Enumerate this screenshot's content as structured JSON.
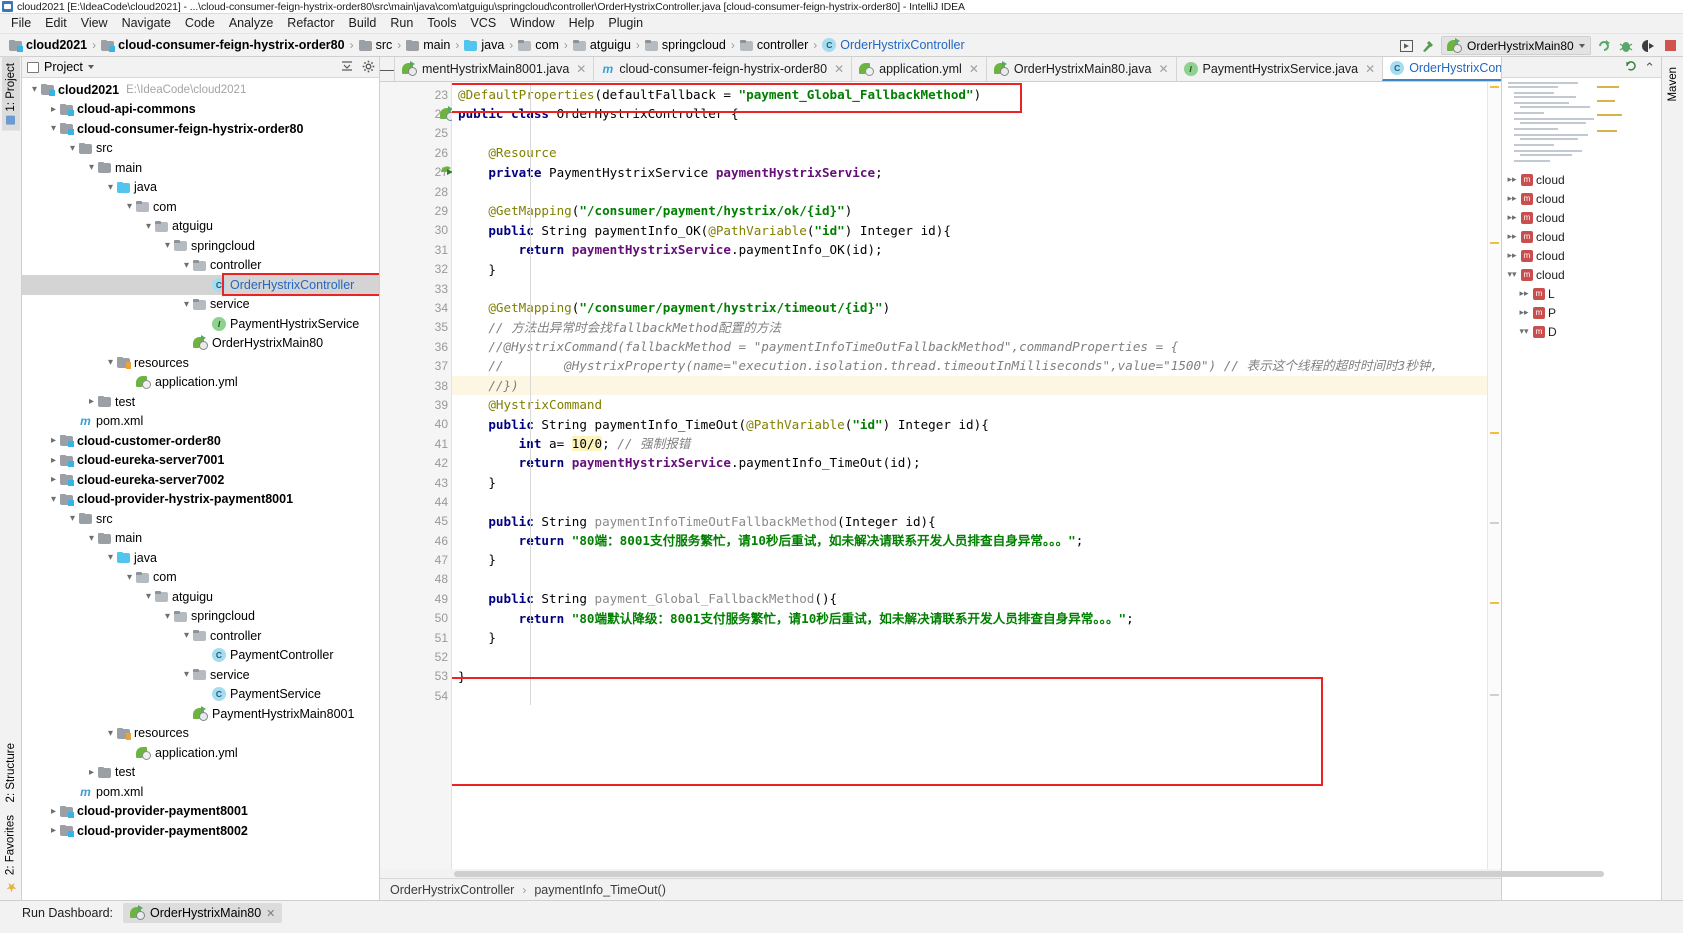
{
  "window": {
    "title": "cloud2021 [E:\\IdeaCode\\cloud2021] - ...\\cloud-consumer-feign-hystrix-order80\\src\\main\\java\\com\\atguigu\\springcloud\\controller\\OrderHystrixController.java [cloud-consumer-feign-hystrix-order80] - IntelliJ IDEA"
  },
  "menubar": {
    "items": [
      "File",
      "Edit",
      "View",
      "Navigate",
      "Code",
      "Analyze",
      "Refactor",
      "Build",
      "Run",
      "Tools",
      "VCS",
      "Window",
      "Help",
      "Plugin"
    ]
  },
  "breadcrumb": {
    "items": [
      {
        "label": "cloud2021",
        "icon": "module-folder-icon",
        "style": "bold"
      },
      {
        "label": "cloud-consumer-feign-hystrix-order80",
        "icon": "module-folder-icon",
        "style": "bold"
      },
      {
        "label": "src",
        "icon": "folder-icon",
        "style": "normal"
      },
      {
        "label": "main",
        "icon": "folder-icon",
        "style": "normal"
      },
      {
        "label": "java",
        "icon": "source-folder-icon",
        "style": "normal"
      },
      {
        "label": "com",
        "icon": "package-icon",
        "style": "normal"
      },
      {
        "label": "atguigu",
        "icon": "package-icon",
        "style": "normal"
      },
      {
        "label": "springcloud",
        "icon": "package-icon",
        "style": "normal"
      },
      {
        "label": "controller",
        "icon": "package-icon",
        "style": "normal"
      },
      {
        "label": "OrderHystrixController",
        "icon": "class-icon",
        "style": "link"
      }
    ]
  },
  "toolbar": {
    "run_configuration": "OrderHystrixMain80",
    "buttons": [
      "select-run-config",
      "run-button",
      "rerun-button",
      "debug-button",
      "run-with-coverage-button",
      "stop-button"
    ]
  },
  "project_panel": {
    "title": "Project",
    "tree": [
      {
        "depth": 0,
        "twist": "open",
        "icon": "module-folder-icon",
        "label": "cloud2021",
        "bold": true,
        "path": "E:\\IdeaCode\\cloud2021"
      },
      {
        "depth": 1,
        "twist": "closed",
        "icon": "module-folder-icon",
        "label": "cloud-api-commons",
        "bold": true
      },
      {
        "depth": 1,
        "twist": "open",
        "icon": "module-folder-icon",
        "label": "cloud-consumer-feign-hystrix-order80",
        "bold": true
      },
      {
        "depth": 2,
        "twist": "open",
        "icon": "folder-icon",
        "label": "src"
      },
      {
        "depth": 3,
        "twist": "open",
        "icon": "folder-icon",
        "label": "main"
      },
      {
        "depth": 4,
        "twist": "open",
        "icon": "source-folder-icon",
        "label": "java"
      },
      {
        "depth": 5,
        "twist": "open",
        "icon": "package-icon",
        "label": "com"
      },
      {
        "depth": 6,
        "twist": "open",
        "icon": "package-icon",
        "label": "atguigu"
      },
      {
        "depth": 7,
        "twist": "open",
        "icon": "package-icon",
        "label": "springcloud"
      },
      {
        "depth": 8,
        "twist": "open",
        "icon": "package-icon",
        "label": "controller"
      },
      {
        "depth": 9,
        "twist": "none",
        "icon": "class-icon",
        "label": "OrderHystrixController",
        "selected": true,
        "blue": true
      },
      {
        "depth": 8,
        "twist": "open",
        "icon": "package-icon",
        "label": "service"
      },
      {
        "depth": 9,
        "twist": "none",
        "icon": "interface-icon",
        "label": "PaymentHystrixService"
      },
      {
        "depth": 8,
        "twist": "none",
        "icon": "spring-run-icon",
        "label": "OrderHystrixMain80"
      },
      {
        "depth": 4,
        "twist": "open",
        "icon": "resources-folder-icon",
        "label": "resources"
      },
      {
        "depth": 5,
        "twist": "none",
        "icon": "yml-icon",
        "label": "application.yml"
      },
      {
        "depth": 3,
        "twist": "closed",
        "icon": "folder-icon",
        "label": "test"
      },
      {
        "depth": 2,
        "twist": "none",
        "icon": "maven-icon",
        "label": "pom.xml"
      },
      {
        "depth": 1,
        "twist": "closed",
        "icon": "module-folder-icon",
        "label": "cloud-customer-order80",
        "bold": true
      },
      {
        "depth": 1,
        "twist": "closed",
        "icon": "module-folder-icon",
        "label": "cloud-eureka-server7001",
        "bold": true
      },
      {
        "depth": 1,
        "twist": "closed",
        "icon": "module-folder-icon",
        "label": "cloud-eureka-server7002",
        "bold": true
      },
      {
        "depth": 1,
        "twist": "open",
        "icon": "module-folder-icon",
        "label": "cloud-provider-hystrix-payment8001",
        "bold": true
      },
      {
        "depth": 2,
        "twist": "open",
        "icon": "folder-icon",
        "label": "src"
      },
      {
        "depth": 3,
        "twist": "open",
        "icon": "folder-icon",
        "label": "main"
      },
      {
        "depth": 4,
        "twist": "open",
        "icon": "source-folder-icon",
        "label": "java"
      },
      {
        "depth": 5,
        "twist": "open",
        "icon": "package-icon",
        "label": "com"
      },
      {
        "depth": 6,
        "twist": "open",
        "icon": "package-icon",
        "label": "atguigu"
      },
      {
        "depth": 7,
        "twist": "open",
        "icon": "package-icon",
        "label": "springcloud"
      },
      {
        "depth": 8,
        "twist": "open",
        "icon": "package-icon",
        "label": "controller"
      },
      {
        "depth": 9,
        "twist": "none",
        "icon": "class-icon",
        "label": "PaymentController"
      },
      {
        "depth": 8,
        "twist": "open",
        "icon": "package-icon",
        "label": "service"
      },
      {
        "depth": 9,
        "twist": "none",
        "icon": "class-icon",
        "label": "PaymentService"
      },
      {
        "depth": 8,
        "twist": "none",
        "icon": "spring-run-icon",
        "label": "PaymentHystrixMain8001"
      },
      {
        "depth": 4,
        "twist": "open",
        "icon": "resources-folder-icon",
        "label": "resources"
      },
      {
        "depth": 5,
        "twist": "none",
        "icon": "yml-icon",
        "label": "application.yml"
      },
      {
        "depth": 3,
        "twist": "closed",
        "icon": "folder-icon",
        "label": "test"
      },
      {
        "depth": 2,
        "twist": "none",
        "icon": "maven-icon",
        "label": "pom.xml"
      },
      {
        "depth": 1,
        "twist": "closed",
        "icon": "module-folder-icon",
        "label": "cloud-provider-payment8001",
        "bold": true
      },
      {
        "depth": 1,
        "twist": "closed",
        "icon": "module-folder-icon",
        "label": "cloud-provider-payment8002",
        "bold": true
      }
    ]
  },
  "left_tool_strip": {
    "items": [
      "1: Project",
      "2: Structure",
      "2: Favorites"
    ]
  },
  "right_tool_strip": {
    "items": [
      "Maven"
    ]
  },
  "editor_tabs": [
    {
      "label": "mentHystrixMain8001.java",
      "icon": "spring-run-icon",
      "active": false
    },
    {
      "label": "cloud-consumer-feign-hystrix-order80",
      "icon": "maven-icon",
      "active": false
    },
    {
      "label": "application.yml",
      "icon": "yml-icon",
      "active": false
    },
    {
      "label": "OrderHystrixMain80.java",
      "icon": "spring-run-icon",
      "active": false
    },
    {
      "label": "PaymentHystrixService.java",
      "icon": "interface-icon",
      "active": false
    },
    {
      "label": "OrderHystrixController.java",
      "icon": "class-icon",
      "active": true
    }
  ],
  "editor_tab_overflow": "4",
  "maven_panel_title": "Maven",
  "code": {
    "first_line_number": 23,
    "lines": [
      {
        "n": 23,
        "gmark": "fold-top",
        "runmark": "",
        "html": "<span class=\"ann\">@DefaultProperties</span><span class=\"pln\">(defaultFallback = </span><span class=\"str\">\"payment_Global_FallbackMethod\"</span><span class=\"pln\">)</span>",
        "text": "@DefaultProperties(defaultFallback = \"payment_Global_FallbackMethod\")"
      },
      {
        "n": 24,
        "gmark": "",
        "runmark": "class-run",
        "html": "<span class=\"kw\">public class </span><span class=\"pln\">OrderHystrixController {</span>",
        "text": "public class OrderHystrixController {"
      },
      {
        "n": 25,
        "gmark": "",
        "runmark": "",
        "html": "",
        "text": ""
      },
      {
        "n": 26,
        "gmark": "",
        "runmark": "",
        "html": "    <span class=\"ann\">@Resource</span>",
        "text": "    @Resource"
      },
      {
        "n": 27,
        "gmark": "",
        "runmark": "bean",
        "html": "    <span class=\"kw\">private </span><span class=\"pln\">PaymentHystrixService </span><span class=\"fld\">paymentHystrixService</span><span class=\"pln\">;</span>",
        "text": "    private PaymentHystrixService paymentHystrixService;"
      },
      {
        "n": 28,
        "gmark": "",
        "runmark": "",
        "html": "",
        "text": ""
      },
      {
        "n": 29,
        "gmark": "",
        "runmark": "",
        "html": "    <span class=\"ann\">@GetMapping</span><span class=\"pln\">(</span><span class=\"str\">\"/consumer/payment/hystrix/ok/{id}\"</span><span class=\"pln\">)</span>",
        "text": "    @GetMapping(\"/consumer/payment/hystrix/ok/{id}\")"
      },
      {
        "n": 30,
        "gmark": "fold-top",
        "runmark": "",
        "html": "    <span class=\"kw\">public </span><span class=\"pln\">String paymentInfo_OK(</span><span class=\"ann\">@PathVariable</span><span class=\"pln\">(</span><span class=\"str\">\"id\"</span><span class=\"pln\">) Integer id){</span>",
        "text": "    public String paymentInfo_OK(@PathVariable(\"id\") Integer id){"
      },
      {
        "n": 31,
        "gmark": "",
        "runmark": "",
        "html": "        <span class=\"kw\">return </span><span class=\"fld\">paymentHystrixService</span><span class=\"pln\">.paymentInfo_OK(id);</span>",
        "text": "        return paymentHystrixService.paymentInfo_OK(id);"
      },
      {
        "n": 32,
        "gmark": "fold-bot",
        "runmark": "",
        "html": "    <span class=\"pln\">}</span>",
        "text": "    }"
      },
      {
        "n": 33,
        "gmark": "",
        "runmark": "",
        "html": "",
        "text": ""
      },
      {
        "n": 34,
        "gmark": "fold-top",
        "runmark": "",
        "html": "    <span class=\"ann\">@GetMapping</span><span class=\"pln\">(</span><span class=\"str\">\"/consumer/payment/hystrix/timeout/{id}\"</span><span class=\"pln\">)</span>",
        "text": "    @GetMapping(\"/consumer/payment/hystrix/timeout/{id}\")"
      },
      {
        "n": 35,
        "gmark": "",
        "runmark": "",
        "html": "    <span class=\"cmt\">// 方法出异常时会找fallbackMethod配置的方法</span>",
        "text": "    // 方法出异常时会找fallbackMethod配置的方法"
      },
      {
        "n": 36,
        "gmark": "",
        "runmark": "",
        "html": "    <span class=\"cmt\">//@HystrixCommand(fallbackMethod = \"paymentInfoTimeOutFallbackMethod\",commandProperties = {</span>",
        "text": "    //@HystrixCommand(fallbackMethod = \"paymentInfoTimeOutFallbackMethod\",commandProperties = {"
      },
      {
        "n": 37,
        "gmark": "",
        "runmark": "",
        "html": "    <span class=\"cmt\">//        @HystrixProperty(name=\"execution.isolation.thread.timeoutInMilliseconds\",value=\"1500\") // 表示这个线程的超时时间时3秒钟,</span>",
        "text": "    //        @HystrixProperty(name=\"execution.isolation.thread.timeoutInMilliseconds\",value=\"1500\") // 表示这个线程的超时时间时3秒钟,"
      },
      {
        "n": 38,
        "gmark": "",
        "runmark": "",
        "hl": true,
        "html": "    <span class=\"cmt\">//})</span>",
        "text": "    //})"
      },
      {
        "n": 39,
        "gmark": "fold-top",
        "runmark": "",
        "html": "    <span class=\"ann\">@HystrixCommand</span>",
        "text": "    @HystrixCommand"
      },
      {
        "n": 40,
        "gmark": "fold-top",
        "runmark": "",
        "html": "    <span class=\"kw\">public </span><span class=\"pln\">String paymentInfo_TimeOut(</span><span class=\"ann\">@PathVariable</span><span class=\"pln\">(</span><span class=\"str\">\"id\"</span><span class=\"pln\">) Integer id){</span>",
        "text": "    public String paymentInfo_TimeOut(@PathVariable(\"id\") Integer id){"
      },
      {
        "n": 41,
        "gmark": "",
        "runmark": "",
        "html": "        <span class=\"kw\">int </span><span class=\"pln\">a= </span><span class=\"num\">10/0</span><span class=\"pln\">; </span><span class=\"cmt\">// 强制报错</span>",
        "text": "        int a= 10/0; // 强制报错"
      },
      {
        "n": 42,
        "gmark": "",
        "runmark": "",
        "html": "        <span class=\"kw\">return </span><span class=\"fld\">paymentHystrixService</span><span class=\"pln\">.paymentInfo_TimeOut(id);</span>",
        "text": "        return paymentHystrixService.paymentInfo_TimeOut(id);"
      },
      {
        "n": 43,
        "gmark": "fold-bot",
        "runmark": "",
        "html": "    <span class=\"pln\">}</span>",
        "text": "    }"
      },
      {
        "n": 44,
        "gmark": "",
        "runmark": "",
        "html": "",
        "text": ""
      },
      {
        "n": 45,
        "gmark": "fold-top",
        "runmark": "",
        "html": "    <span class=\"kw\">public </span><span class=\"pln\">String </span><span class=\"mthg\">paymentInfoTimeOutFallbackMethod</span><span class=\"pln\">(Integer id){</span>",
        "text": "    public String paymentInfoTimeOutFallbackMethod(Integer id){"
      },
      {
        "n": 46,
        "gmark": "",
        "runmark": "",
        "html": "        <span class=\"kw\">return </span><span class=\"str\">\"80端：8001支付服务繁忙，请10秒后重试，如未解决请联系开发人员排查自身异常。。。\"</span><span class=\"pln\">;</span>",
        "text": "        return \"80端：8001支付服务繁忙，请10秒后重试，如未解决请联系开发人员排查自身异常。。。\";"
      },
      {
        "n": 47,
        "gmark": "fold-bot",
        "runmark": "",
        "html": "    <span class=\"pln\">}</span>",
        "text": "    }"
      },
      {
        "n": 48,
        "gmark": "",
        "runmark": "",
        "html": "",
        "text": ""
      },
      {
        "n": 49,
        "gmark": "fold-top",
        "runmark": "",
        "html": "    <span class=\"kw\">public </span><span class=\"pln\">String </span><span class=\"mthg\">payment_Global_FallbackMethod</span><span class=\"pln\">(){</span>",
        "text": "    public String payment_Global_FallbackMethod(){"
      },
      {
        "n": 50,
        "gmark": "",
        "runmark": "",
        "html": "        <span class=\"kw\">return </span><span class=\"str\">\"80端默认降级：8001支付服务繁忙，请10秒后重试，如未解决请联系开发人员排查自身异常。。。\"</span><span class=\"pln\">;</span>",
        "text": "        return \"80端默认降级：8001支付服务繁忙，请10秒后重试，如未解决请联系开发人员排查自身异常。。。\";"
      },
      {
        "n": 51,
        "gmark": "fold-bot",
        "runmark": "",
        "html": "    <span class=\"pln\">}</span>",
        "text": "    }"
      },
      {
        "n": 52,
        "gmark": "",
        "runmark": "",
        "html": "",
        "text": ""
      },
      {
        "n": 53,
        "gmark": "",
        "runmark": "",
        "html": "<span class=\"pln\">}</span>",
        "text": "}"
      },
      {
        "n": 54,
        "gmark": "",
        "runmark": "",
        "html": "",
        "text": ""
      }
    ]
  },
  "editor_breadcrumb": {
    "items": [
      "OrderHystrixController",
      "paymentInfo_TimeOut()"
    ]
  },
  "bottom": {
    "run_dashboard_label": "Run Dashboard:",
    "active_tab": "OrderHystrixMain80"
  },
  "annotations": {
    "highlight_color": "#ec2324",
    "boxes": [
      "default-properties-annotation",
      "tree-selected-class",
      "global-fallback-method"
    ]
  },
  "maven_tree": [
    {
      "twist": "closed",
      "label": "cloud"
    },
    {
      "twist": "closed",
      "label": "cloud"
    },
    {
      "twist": "closed",
      "label": "cloud"
    },
    {
      "twist": "closed",
      "label": "cloud"
    },
    {
      "twist": "closed",
      "label": "cloud"
    },
    {
      "twist": "open",
      "label": "cloud"
    },
    {
      "twist": "closed",
      "label": "L"
    },
    {
      "twist": "closed",
      "label": "P"
    },
    {
      "twist": "open",
      "label": "D"
    }
  ]
}
